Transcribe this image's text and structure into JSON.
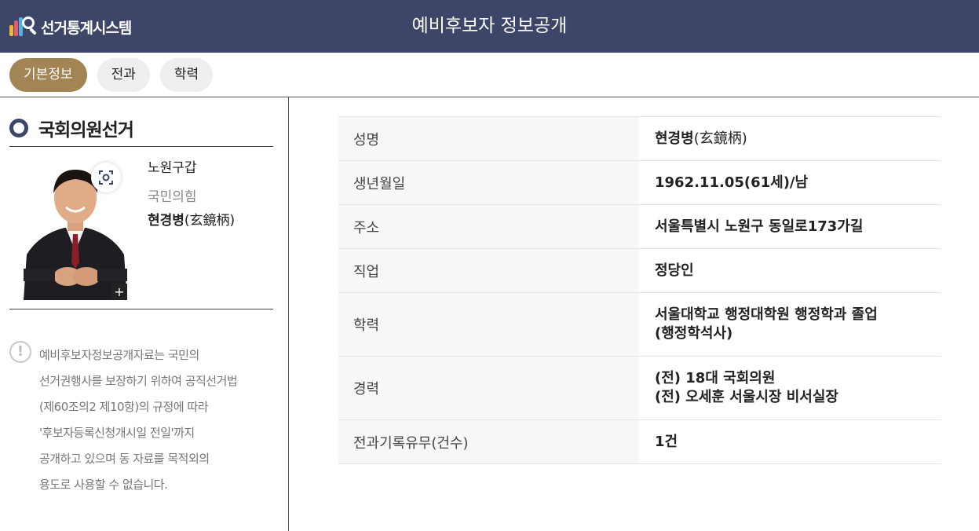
{
  "header": {
    "logo_text": "선거통계시스템",
    "title": "예비후보자 정보공개"
  },
  "tabs": [
    {
      "label": "기본정보",
      "active": true
    },
    {
      "label": "전과",
      "active": false
    },
    {
      "label": "학력",
      "active": false
    }
  ],
  "sidebar": {
    "election_type": "국회의원선거",
    "district": "노원구갑",
    "party": "국민의힘",
    "name": "현경병",
    "name_hanja": "(玄鏡柄)",
    "photo_plus": "+",
    "notice_lines": [
      "예비후보자정보공개자료는 국민의",
      "선거권행사를 보장하기 위하여 공직선거법",
      "(제60조의2 제10항)의 규정에 따라",
      "'후보자등록신청개시일 전일'까지",
      "공개하고 있으며 동 자료를 목적외의",
      "용도로 사용할 수 없습니다."
    ]
  },
  "info": {
    "name_label": "성명",
    "name_value": "현경병",
    "name_hanja": "(玄鏡柄)",
    "birth_label": "생년월일",
    "birth_value": "1962.11.05(61세)/남",
    "address_label": "주소",
    "address_value": "서울특별시 노원구 동일로173가길",
    "job_label": "직업",
    "job_value": "정당인",
    "education_label": "학력",
    "education_line1": "서울대학교 행정대학원 행정학과 졸업",
    "education_line2": "(행정학석사)",
    "career_label": "경력",
    "career_line1": "(전) 18대 국회의원",
    "career_line2": "(전) 오세훈 서울시장 비서실장",
    "criminal_label": "전과기록유무(건수)",
    "criminal_value": "1건"
  }
}
